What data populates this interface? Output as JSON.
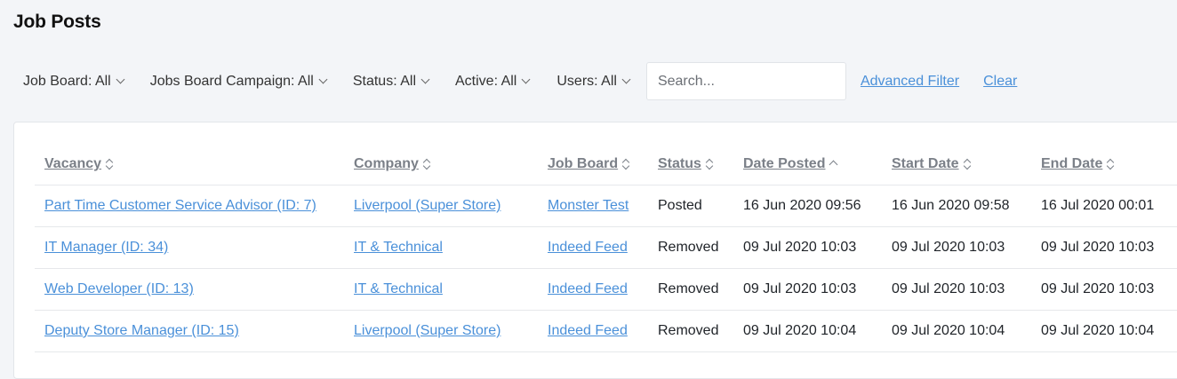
{
  "page": {
    "title": "Job Posts"
  },
  "filters": {
    "job_board": "Job Board: All",
    "campaign": "Jobs Board Campaign: All",
    "status": "Status: All",
    "active": "Active: All",
    "users": "Users: All",
    "search_placeholder": "Search...",
    "advanced_filter": "Advanced Filter",
    "clear": "Clear"
  },
  "table": {
    "columns": {
      "vacancy": "Vacancy",
      "company": "Company",
      "job_board": "Job Board",
      "status": "Status",
      "date_posted": "Date Posted",
      "start_date": "Start Date",
      "end_date": "End Date"
    },
    "sorted_by": "date_posted",
    "sort_direction": "ascending",
    "rows": [
      {
        "vacancy": "Part Time Customer Service Advisor (ID: 7)",
        "company": "Liverpool (Super Store)",
        "job_board": "Monster Test",
        "status": "Posted",
        "date_posted": "16 Jun 2020 09:56",
        "start_date": "16 Jun 2020 09:58",
        "end_date": "16 Jul 2020 00:01"
      },
      {
        "vacancy": "IT Manager (ID: 34)",
        "company": "IT & Technical",
        "job_board": "Indeed Feed",
        "status": "Removed",
        "date_posted": "09 Jul 2020 10:03",
        "start_date": "09 Jul 2020 10:03",
        "end_date": "09 Jul 2020 10:03"
      },
      {
        "vacancy": "Web Developer (ID: 13)",
        "company": "IT & Technical",
        "job_board": "Indeed Feed",
        "status": "Removed",
        "date_posted": "09 Jul 2020 10:03",
        "start_date": "09 Jul 2020 10:03",
        "end_date": "09 Jul 2020 10:03"
      },
      {
        "vacancy": "Deputy Store Manager (ID: 15)",
        "company": "Liverpool (Super Store)",
        "job_board": "Indeed Feed",
        "status": "Removed",
        "date_posted": "09 Jul 2020 10:04",
        "start_date": "09 Jul 2020 10:04",
        "end_date": "09 Jul 2020 10:04"
      }
    ]
  },
  "colors": {
    "link": "#4a90d9",
    "page_background": "#f3f5f8",
    "header_text": "#7b8088"
  }
}
